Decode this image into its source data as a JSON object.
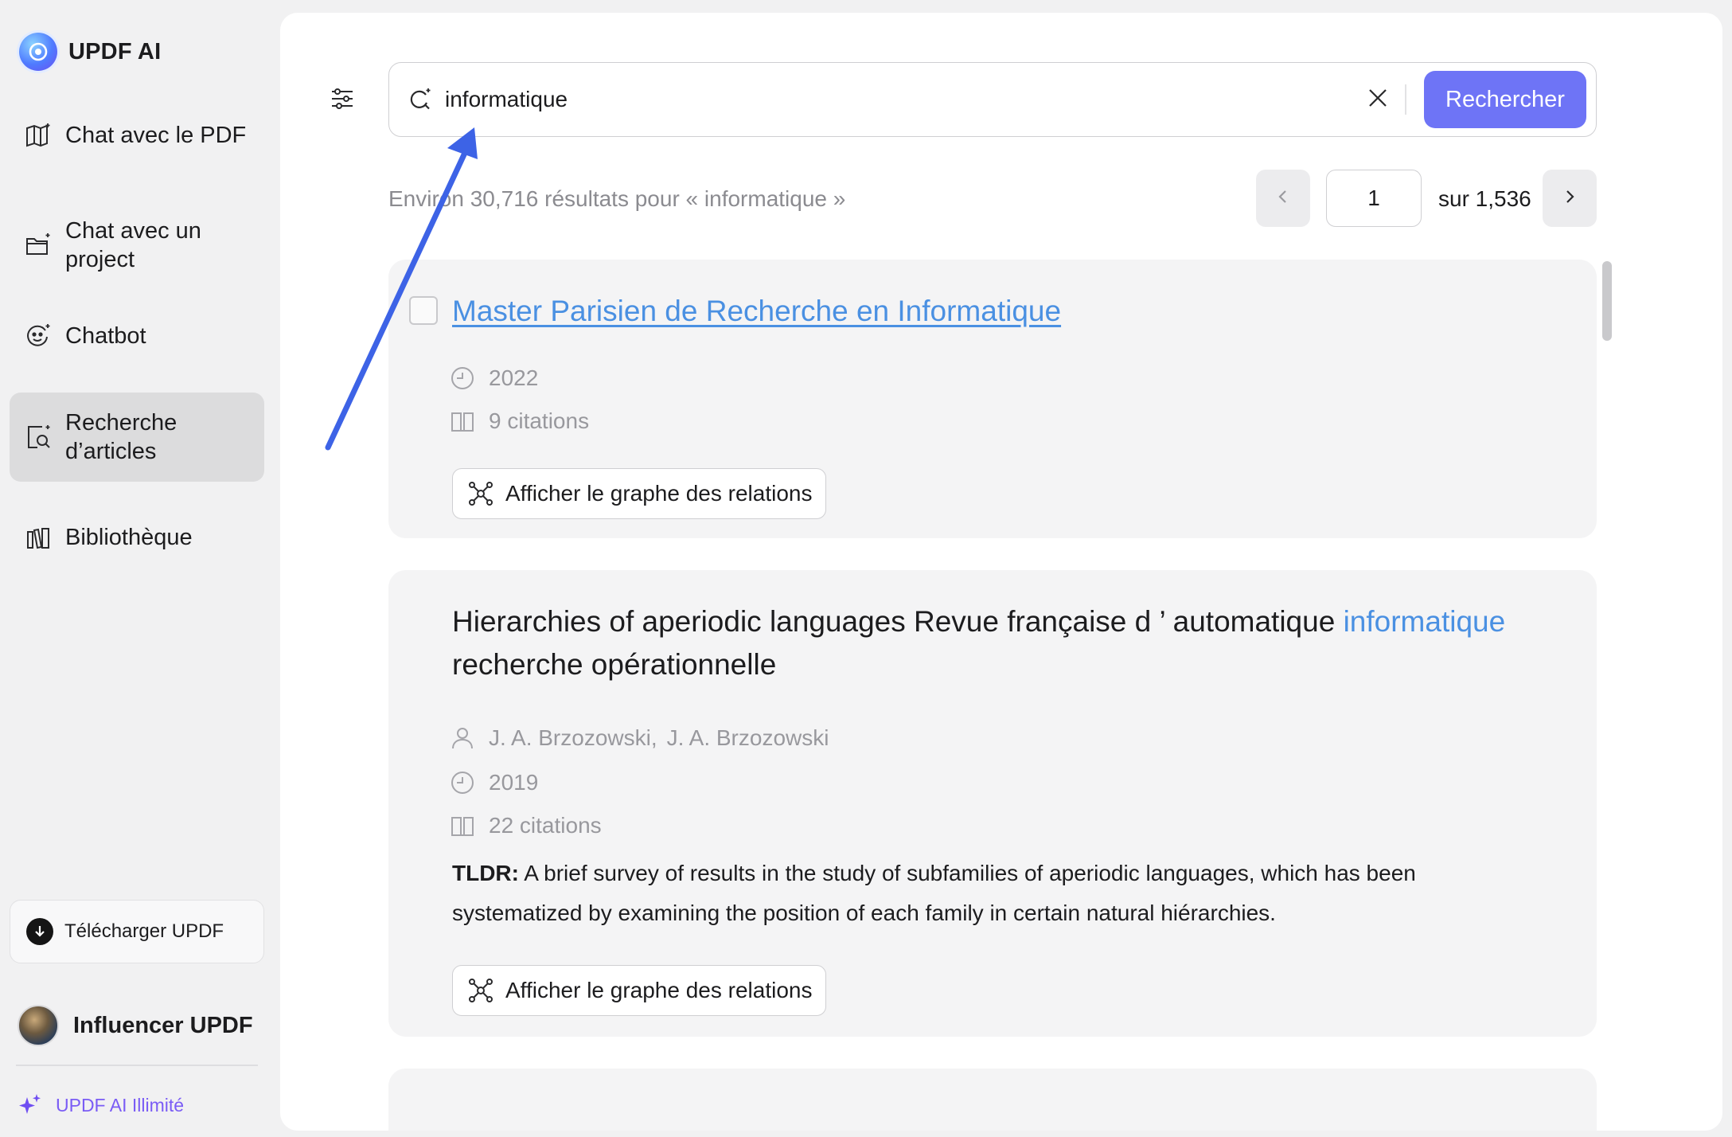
{
  "app": {
    "title": "UPDF AI"
  },
  "sidebar": {
    "items": [
      {
        "label": "Chat avec le PDF",
        "icon": "book-sparkle-icon"
      },
      {
        "label": "Chat avec un project",
        "icon": "folder-sparkle-icon"
      },
      {
        "label": "Chatbot",
        "icon": "chatbot-face-icon"
      },
      {
        "label": "Recherche d’articles",
        "icon": "document-search-icon",
        "active": true
      },
      {
        "label": "Bibliothèque",
        "icon": "library-icon"
      }
    ],
    "download_label": "Télécharger UPDF",
    "user_name": "Influencer UPDF",
    "premium_label": "UPDF AI Illimité"
  },
  "search": {
    "value": "informatique",
    "placeholder": "",
    "submit_label": "Rechercher",
    "results_count": "Environ 30,716 résultats pour « informatique »"
  },
  "pagination": {
    "current": "1",
    "total_label": "sur 1,536"
  },
  "results": [
    {
      "title": "Master Parisien de Recherche en Informatique",
      "year": "2022",
      "citations": "9 citations",
      "graph_label": "Afficher le graphe des relations"
    },
    {
      "title_before": "Hierarchies of aperiodic languages Revue française d ’ automatique ",
      "title_highlight": "informatique",
      "title_after": " recherche opérationnelle",
      "authors": [
        "J. A. Brzozowski,",
        "J. A. Brzozowski"
      ],
      "year": "2019",
      "citations": "22 citations",
      "tldr_label": "TLDR:",
      "tldr": " A brief survey of results in the study of subfamilies of aperiodic languages, which has been systematized by examining the position of each family in certain natural hiérarchies.",
      "graph_label": "Afficher le graphe des relations"
    }
  ],
  "colors": {
    "accent": "#6e74f6",
    "link": "#4a90e2",
    "annotation_arrow": "#3d63e6",
    "premium": "#7a5cf5"
  }
}
